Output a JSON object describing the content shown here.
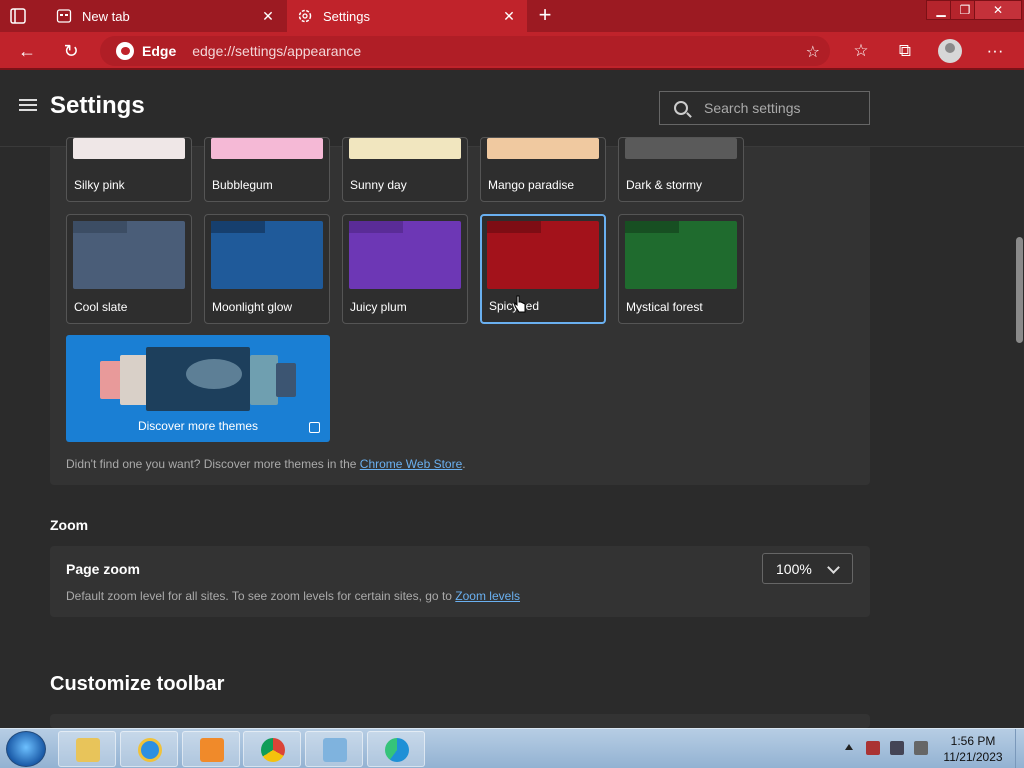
{
  "browser": {
    "tabs": [
      {
        "label": "New tab",
        "close": "✕"
      },
      {
        "label": "Settings",
        "close": "✕"
      }
    ],
    "new_tab_glyph": "+",
    "window_buttons": {
      "minimize": "▁",
      "restore": "❐",
      "close": "✕"
    },
    "nav": {
      "back": "←",
      "reload": "↻"
    },
    "address": {
      "brand": "Edge",
      "url": "edge://settings/appearance"
    },
    "toolbar_icons": {
      "favorite_star": "☆",
      "favorites": "☆",
      "collections": "⧉",
      "more": "···"
    },
    "accent_color": "#c0232b"
  },
  "settings": {
    "title": "Settings",
    "search_placeholder": "Search settings",
    "themes_row1": [
      {
        "name": "Silky pink",
        "color": "#efe7e7"
      },
      {
        "name": "Bubblegum",
        "color": "#f5b9d6"
      },
      {
        "name": "Sunny day",
        "color": "#f1e6bf"
      },
      {
        "name": "Mango paradise",
        "color": "#f0c9a0"
      },
      {
        "name": "Dark & stormy",
        "color": "#5a5a5a"
      }
    ],
    "themes_row2": [
      {
        "name": "Cool slate",
        "color": "#4a5d78",
        "tab": "#3c4d64"
      },
      {
        "name": "Moonlight glow",
        "color": "#1f5a9a",
        "tab": "#163f6e"
      },
      {
        "name": "Juicy plum",
        "color": "#6d37b5",
        "tab": "#5a2c97"
      },
      {
        "name": "Spicy red",
        "color": "#a3121b",
        "tab": "#7e0d14",
        "selected": true
      },
      {
        "name": "Mystical forest",
        "color": "#1f6b2e",
        "tab": "#174f22"
      }
    ],
    "discover": {
      "label": "Discover more themes"
    },
    "helper": {
      "text": "Didn't find one you want? Discover more themes in the ",
      "link": "Chrome Web Store",
      "suffix": "."
    },
    "zoom": {
      "section_title": "Zoom",
      "label": "Page zoom",
      "description": "Default zoom level for all sites. To see zoom levels for certain sites, go to ",
      "link": "Zoom levels",
      "value": "100%"
    },
    "customize_toolbar": {
      "section_title": "Customize toolbar"
    }
  },
  "taskbar": {
    "time": "1:56 PM",
    "date": "11/21/2023"
  }
}
